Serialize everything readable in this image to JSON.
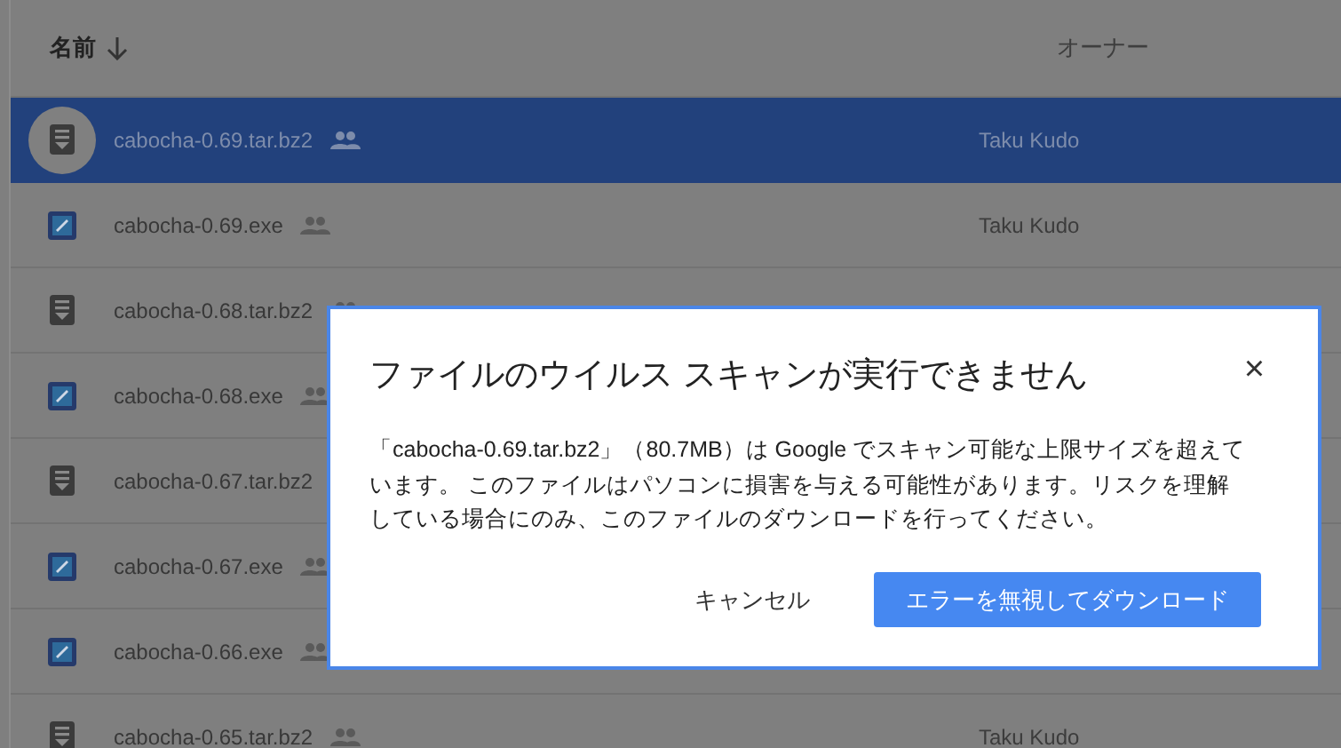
{
  "columns": [
    {
      "label": "名前",
      "sorted": true
    },
    {
      "label": "オーナー",
      "sorted": false
    }
  ],
  "rows": [
    {
      "name": "cabocha-0.69.tar.bz2",
      "kind": "archive",
      "shared": true,
      "owner": "Taku Kudo",
      "selected": true
    },
    {
      "name": "cabocha-0.69.exe",
      "kind": "exe",
      "shared": true,
      "owner": "Taku Kudo",
      "selected": false
    },
    {
      "name": "cabocha-0.68.tar.bz2",
      "kind": "archive",
      "shared": true,
      "selected": false
    },
    {
      "name": "cabocha-0.68.exe",
      "kind": "exe",
      "shared": true,
      "selected": false
    },
    {
      "name": "cabocha-0.67.tar.bz2",
      "kind": "archive",
      "selected": false
    },
    {
      "name": "cabocha-0.67.exe",
      "kind": "exe",
      "shared": true,
      "selected": false
    },
    {
      "name": "cabocha-0.66.exe",
      "kind": "exe",
      "shared": true,
      "selected": false
    },
    {
      "name": "cabocha-0.65.tar.bz2",
      "kind": "archive",
      "shared": true,
      "owner": "Taku Kudo",
      "selected": false
    }
  ],
  "dialog": {
    "title": "ファイルのウイルス スキャンが実行できません",
    "message": "「cabocha-0.69.tar.bz2」（80.7MB）は Google でスキャン可能な上限サイズを超えています。 このファイルはパソコンに損害を与える可能性があります。リスクを理解している場合にのみ、このファイルのダウンロードを行ってください。",
    "close": "×",
    "buttons": [
      {
        "label": "キャンセル",
        "kind": "text"
      },
      {
        "label": "エラーを無視してダウンロード",
        "kind": "primary"
      }
    ]
  }
}
